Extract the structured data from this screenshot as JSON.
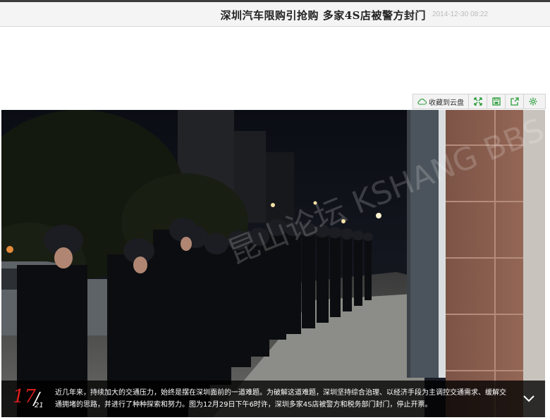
{
  "header": {
    "title": "深圳汽车限购引抢购 多家4S店被警方封门",
    "date": "2014-12-30 08:22"
  },
  "toolbar": {
    "cloud_label": "收藏到云盘",
    "buttons": [
      "fullscreen-icon",
      "save-icon",
      "share-icon",
      "settings-icon"
    ]
  },
  "photo": {
    "watermark": "昆山论坛 KSHANG BBS",
    "current": "17",
    "total": "21",
    "caption": "近几年来，持续加大的交通压力，始终是摆在深圳面前的一道难题。为破解这道难题，深圳坚持综合治理、以经济手段为主调控交通需求、缓解交通拥堵的思路，并进行了种种探索和努力。图为12月29日下午6时许，深圳多家4S店被警方和税务部门封门，停止开票。"
  },
  "colors": {
    "counter_red": "#d9201c",
    "toolbar_green": "#2a9d3a"
  }
}
